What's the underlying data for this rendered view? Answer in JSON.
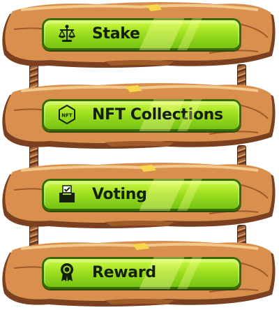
{
  "menu": {
    "items": [
      {
        "label": "Stake",
        "icon": "scale-dollar-icon"
      },
      {
        "label": "NFT Collections",
        "icon": "nft-hexagon-icon"
      },
      {
        "label": "Voting",
        "icon": "ballot-box-icon"
      },
      {
        "label": "Reward",
        "icon": "medal-icon"
      }
    ]
  },
  "colors": {
    "wood": "#d9904f",
    "wood_dark": "#9e5a28",
    "wood_edge": "#7a4020",
    "button_green": "#9fe020",
    "button_border": "#3a6a06",
    "label_text": "#15200a"
  },
  "icon_labels": {
    "nft": "NFT"
  }
}
